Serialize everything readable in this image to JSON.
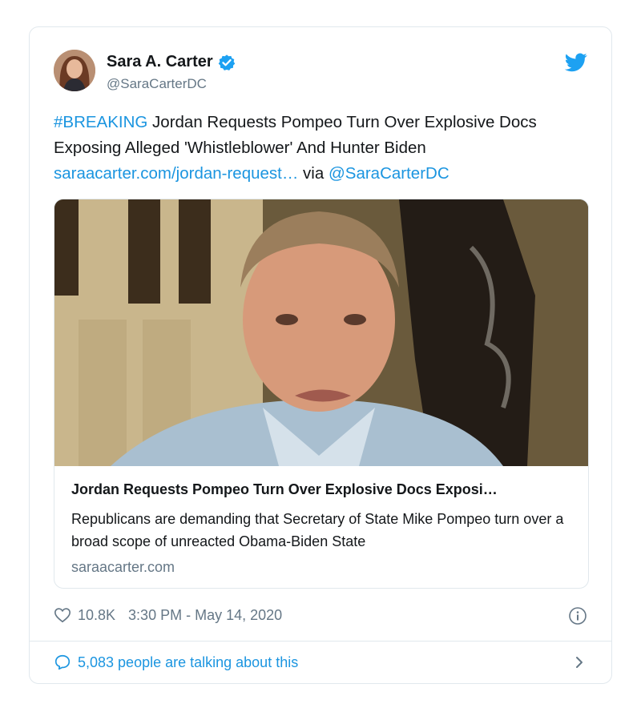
{
  "tweet": {
    "author_name": "Sara A. Carter",
    "author_handle": "@SaraCarterDC",
    "hashtag": "#BREAKING",
    "body_text": " Jordan Requests Pompeo Turn Over Explosive Docs Exposing Alleged 'Whistleblower' And Hunter Biden ",
    "url_text": "saraacarter.com/jordan-request…",
    "via_text": " via ",
    "via_mention": "@SaraCarterDC",
    "likes": "10.8K",
    "timestamp": "3:30 PM - May 14, 2020",
    "conversation": "5,083 people are talking about this"
  },
  "card": {
    "title": "Jordan Requests Pompeo Turn Over Explosive Docs Exposi…",
    "description": "Republicans are demanding that Secretary of State Mike Pompeo turn over a broad scope of unreacted Obama-Biden State",
    "domain": "saraacarter.com"
  },
  "icons": {
    "verified": "verified-badge-icon",
    "bird": "twitter-bird-icon",
    "like": "heart-icon",
    "info": "info-icon",
    "reply": "speech-bubble-icon",
    "chevron": "chevron-right-icon"
  },
  "colors": {
    "link": "#1b95e0",
    "secondary_text": "#657786",
    "border": "#e1e8ed"
  }
}
